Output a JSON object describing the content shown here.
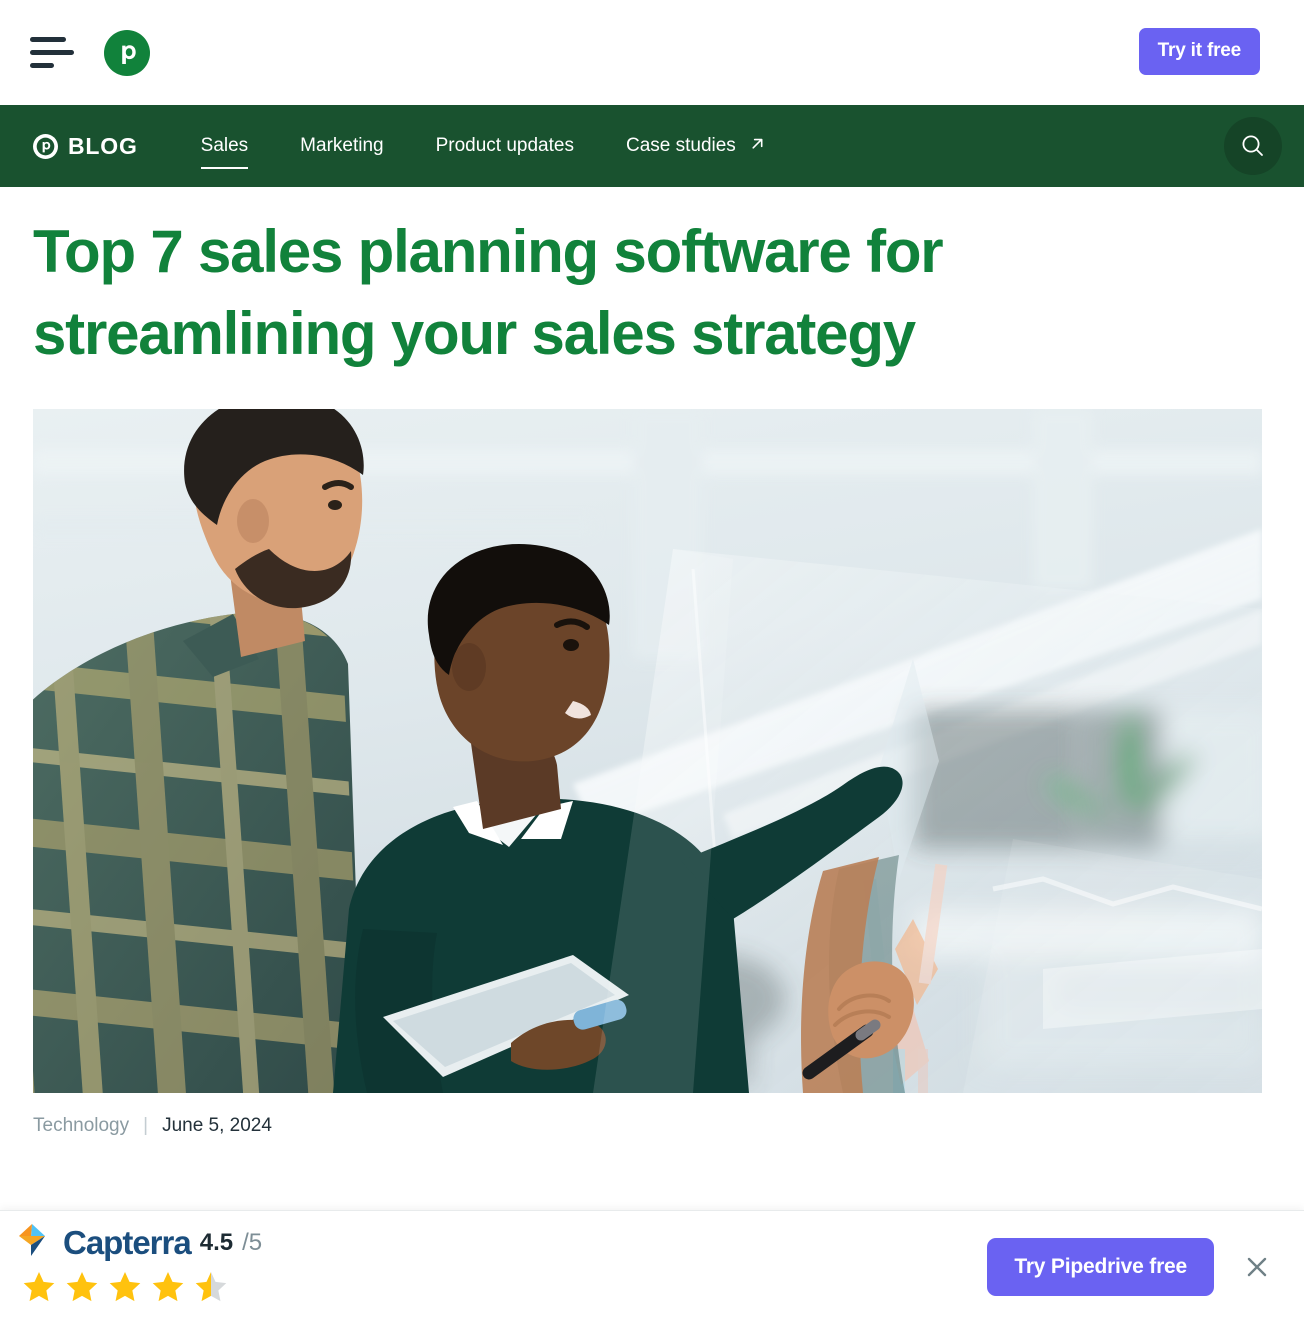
{
  "topbar": {
    "menu_icon": "hamburger-icon",
    "logo_icon": "pipedrive-logo-icon",
    "cta_label": "Try it free"
  },
  "nav": {
    "brand_mark": "pipedrive-circle-icon",
    "brand_label": "BLOG",
    "items": [
      {
        "label": "Sales",
        "active": true,
        "external": false
      },
      {
        "label": "Marketing",
        "active": false,
        "external": false
      },
      {
        "label": "Product updates",
        "active": false,
        "external": false
      },
      {
        "label": "Case studies",
        "active": false,
        "external": true
      }
    ],
    "search_icon": "search-icon",
    "background_color": "#19522F"
  },
  "article": {
    "headline": "Top 7 sales planning software for streamlining your sales strategy",
    "headline_color": "#11823B",
    "hero_alt": "Two colleagues in an office; one writes on a glass wall with a marker while the other holds a tablet",
    "category": "Technology",
    "separator": "|",
    "date": "June 5, 2024"
  },
  "banner": {
    "brand": "Capterra",
    "rating_value": "4.5",
    "rating_scale": "/5",
    "stars_full": 4,
    "stars_half": 1,
    "star_color": "#FFC20E",
    "cta_label": "Try Pipedrive free",
    "cta_color": "#6A62F2",
    "close_icon": "close-icon"
  }
}
